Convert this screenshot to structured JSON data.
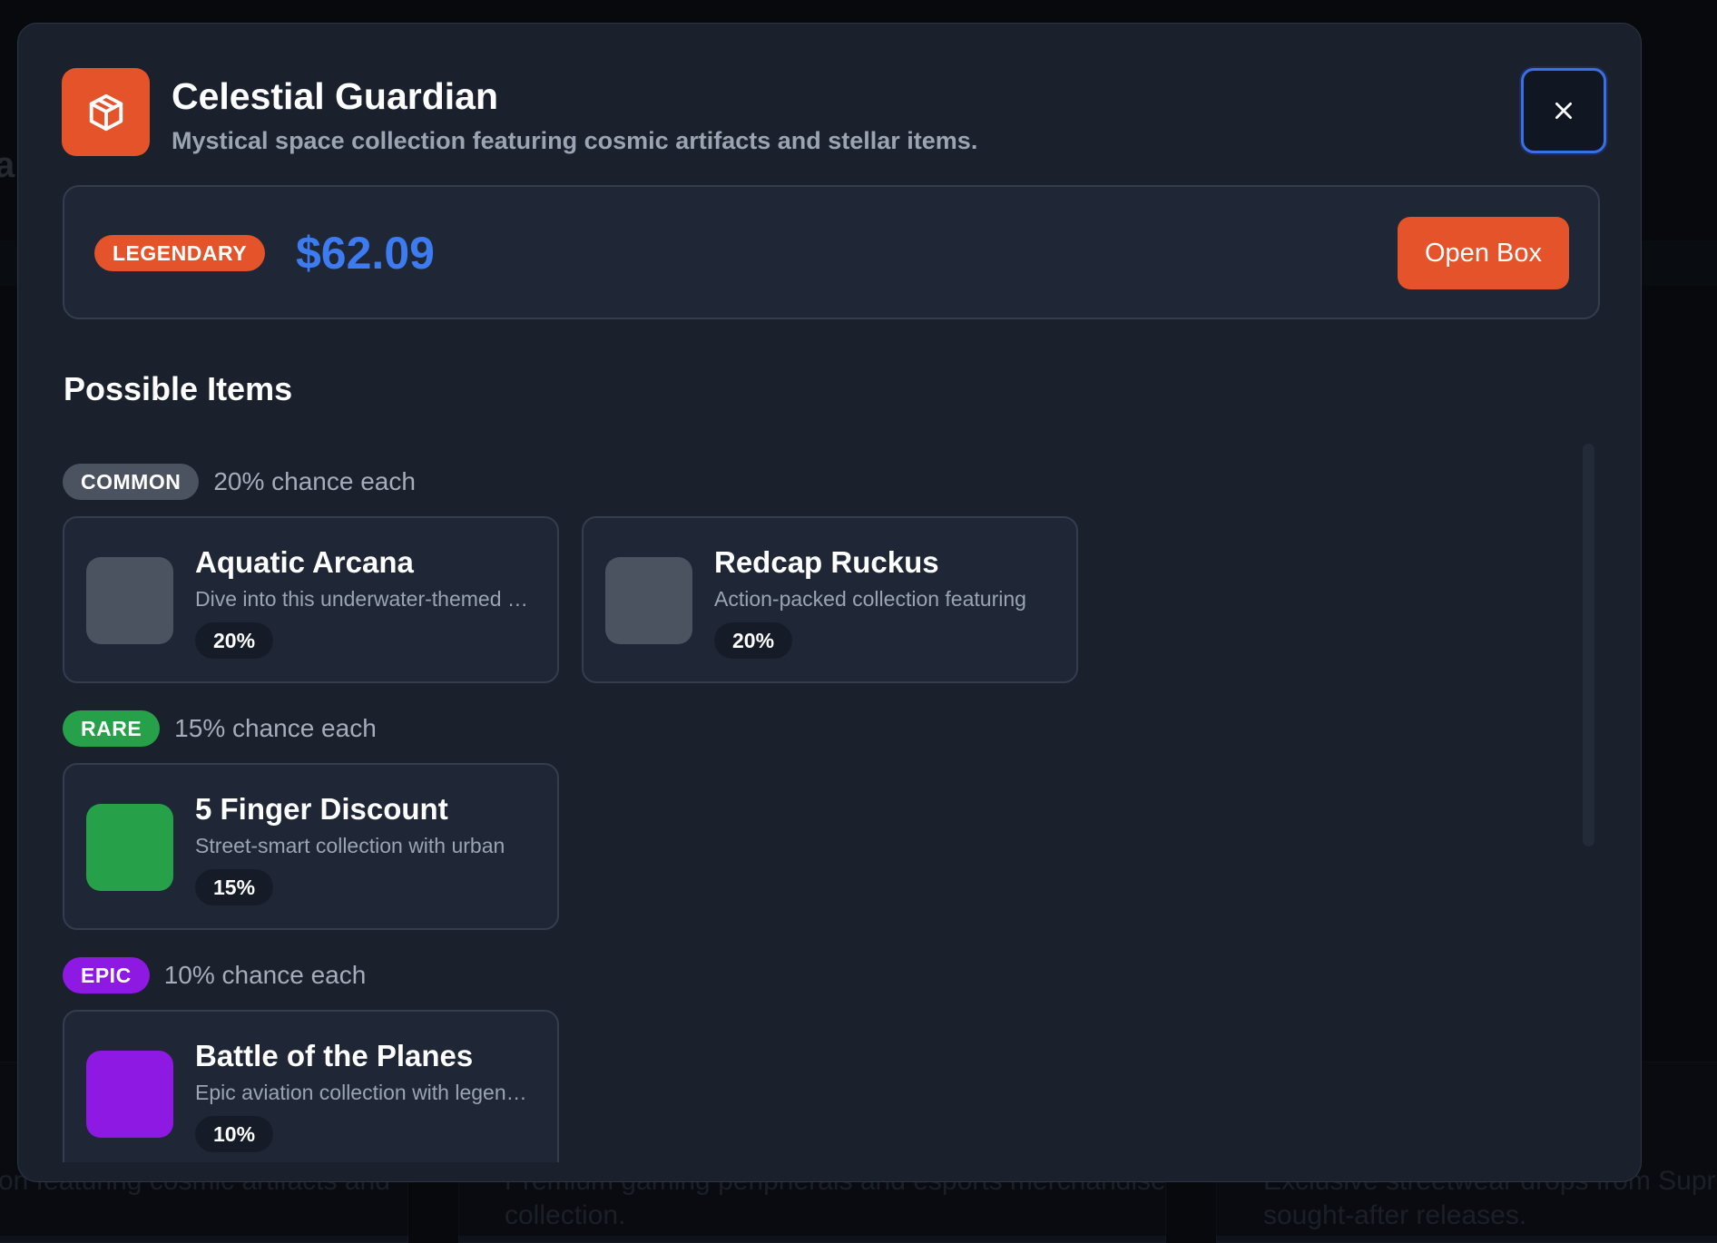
{
  "background": {
    "left_letter_top": "a",
    "left_letter_bottom": "a",
    "text_1": "on featuring cosmic artifacts and",
    "text_2": "Premium gaming peripherals and esports merchandise",
    "text_3": "collection.",
    "text_4": "Exclusive streetwear drops from Suprem",
    "text_5": "sought-after releases."
  },
  "modal": {
    "title": "Celestial Guardian",
    "subtitle": "Mystical space collection featuring cosmic artifacts and stellar items.",
    "logo_icon": "box-icon",
    "close_icon": "close-icon",
    "rarity": "LEGENDARY",
    "price": "$62.09",
    "open_button": "Open Box",
    "section_title": "Possible Items",
    "groups": [
      {
        "rarity": "COMMON",
        "chance": "20% chance each",
        "color": "#4b5260",
        "items": [
          {
            "name": "Aquatic Arcana",
            "description": "Dive into this underwater-themed collection",
            "percent": "20%",
            "color": "#4b5260"
          },
          {
            "name": "Redcap Ruckus",
            "description": "Action-packed collection featuring",
            "percent": "20%",
            "color": "#4b5260"
          }
        ]
      },
      {
        "rarity": "RARE",
        "chance": "15% chance each",
        "color": "#26a049",
        "items": [
          {
            "name": "5 Finger Discount",
            "description": "Street-smart collection with urban",
            "percent": "15%",
            "color": "#26a049"
          }
        ]
      },
      {
        "rarity": "EPIC",
        "chance": "10% chance each",
        "color": "#8d19e3",
        "items": [
          {
            "name": "Battle of the Planes",
            "description": "Epic aviation collection with legendary",
            "percent": "10%",
            "color": "#8d19e3"
          }
        ]
      }
    ]
  },
  "colors": {
    "accent": "#e4532a",
    "price": "#3d7bf0",
    "focus_ring": "#3b6fe6"
  }
}
